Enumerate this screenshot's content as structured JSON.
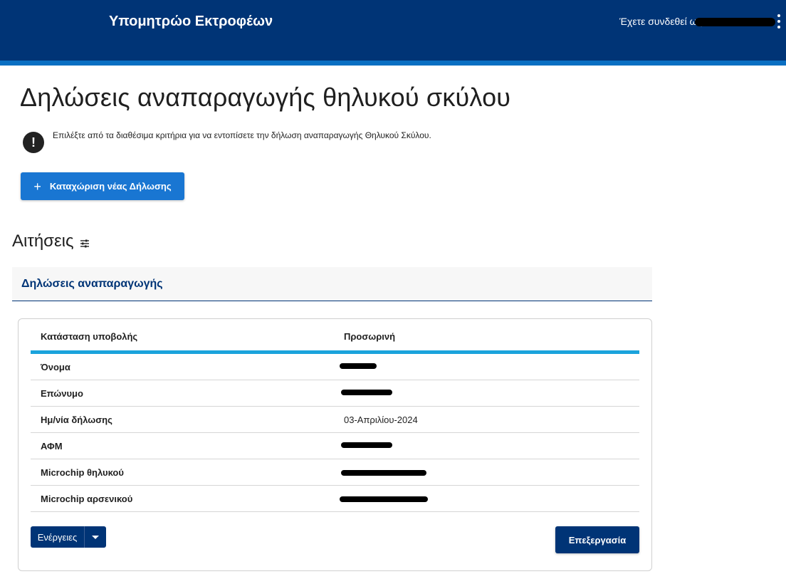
{
  "header": {
    "app_title": "Υπομητρώο Εκτροφέων",
    "login_label": "Έχετε συνδεθεί ως",
    "menu_icon": "kebab-vertical-icon"
  },
  "page": {
    "title": "Δηλώσεις αναπαραγωγής θηλυκού σκύλου",
    "info_icon": "exclamation-circle-icon",
    "info_text": "Επιλέξτε από τα διαθέσιμα κριτήρια για να εντοπίσετε την δήλωση αναπαραγωγής Θηλυκού Σκύλου.",
    "new_button_icon": "+",
    "new_button_label": "Καταχώριση νέας Δήλωσης"
  },
  "section": {
    "title": "Αιτήσεις",
    "filter_icon": "filter-sliders-icon"
  },
  "tab": {
    "label": "Δηλώσεις αναπαραγωγής"
  },
  "details": {
    "header": {
      "label": "Κατάσταση υποβολής",
      "value": "Προσωρινή"
    },
    "rows": [
      {
        "label": "Όνομα",
        "value": ""
      },
      {
        "label": "Επώνυμο",
        "value": ""
      },
      {
        "label": "Ημ/νία δήλωσης",
        "value": "03-Απριλίου-2024"
      },
      {
        "label": "ΑΦΜ",
        "value": ""
      },
      {
        "label": "Microchip θηλυκού",
        "value": ""
      },
      {
        "label": "Microchip αρσενικού",
        "value": ""
      }
    ]
  },
  "buttons": {
    "actions_label": "Ενέργειες",
    "edit_label": "Επεξεργασία"
  },
  "colors": {
    "header_bg": "#003476",
    "accent_blue": "#1976d2",
    "table_accent": "#1aa3dc"
  }
}
